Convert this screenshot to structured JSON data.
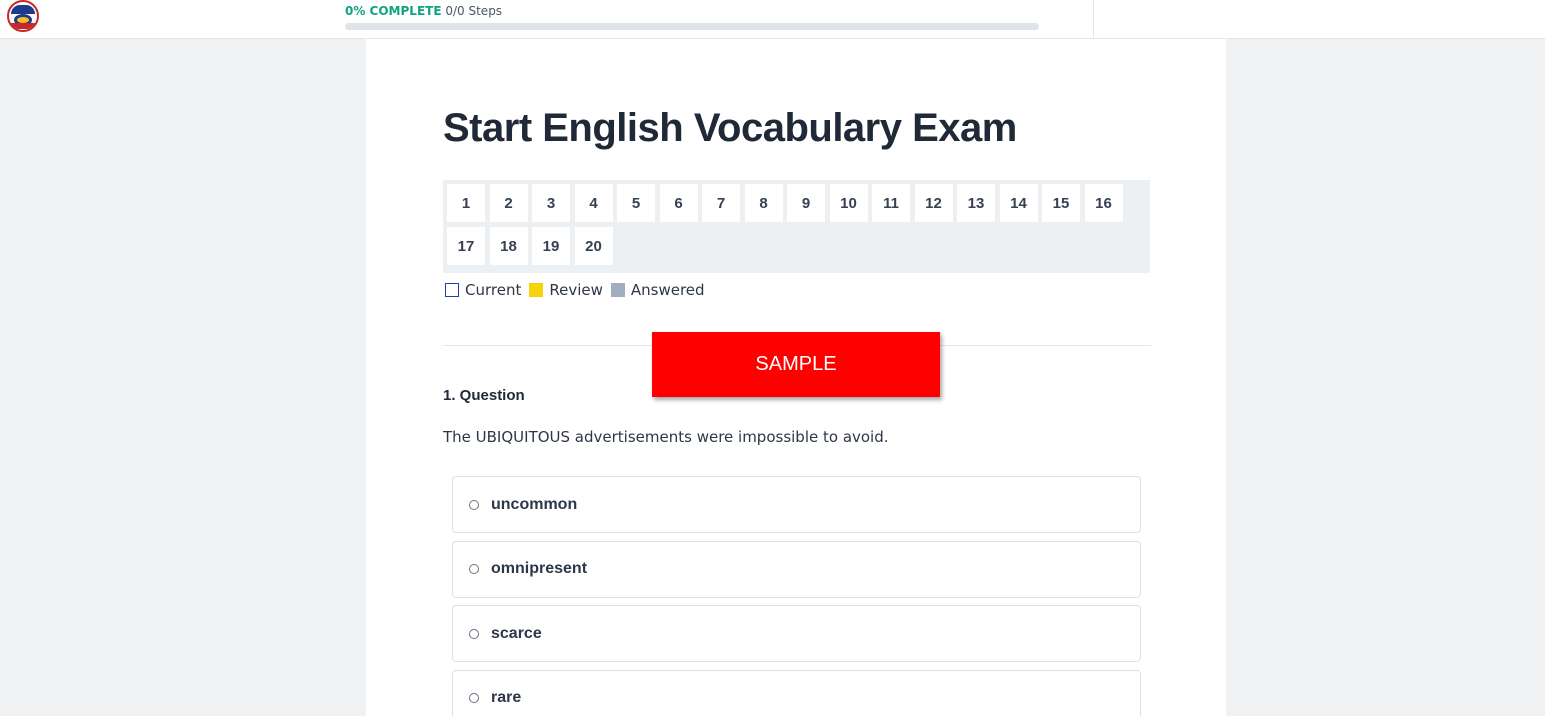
{
  "header": {
    "progress_percent_label": "0% COMPLETE",
    "progress_steps_label": "0/0 Steps",
    "progress_value": 0
  },
  "exam": {
    "title": "Start English Vocabulary Exam",
    "question_numbers": [
      "1",
      "2",
      "3",
      "4",
      "5",
      "6",
      "7",
      "8",
      "9",
      "10",
      "11",
      "12",
      "13",
      "14",
      "15",
      "16",
      "17",
      "18",
      "19",
      "20"
    ],
    "legend": {
      "current": "Current",
      "review": "Review",
      "answered": "Answered"
    }
  },
  "watermark": "SAMPLE",
  "question": {
    "heading": "1. Question",
    "text": "The UBIQUITOUS advertisements were impossible to avoid.",
    "options": [
      "uncommon",
      "omnipresent",
      "scarce",
      "rare"
    ]
  },
  "colors": {
    "accent_green": "#10a37f",
    "review_yellow": "#f7d40a",
    "answered_gray": "#a0aec0",
    "current_border": "#1e40af",
    "watermark_red": "#ff0000"
  }
}
